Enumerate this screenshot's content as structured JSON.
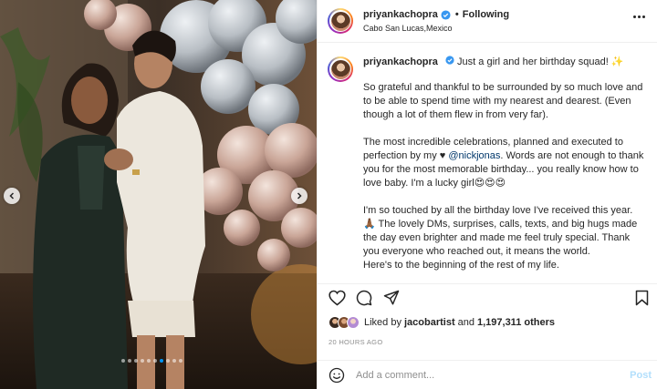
{
  "header": {
    "username": "priyankachopra",
    "separator": "•",
    "follow_status": "Following",
    "location": "Cabo San Lucas,Mexico"
  },
  "caption": {
    "username": "priyankachopra",
    "first_line": "Just a girl and her birthday squad! ✨",
    "paragraphs": [
      "So grateful and thankful to be surrounded by so much love and to be able to spend time with my nearest and dearest. (Even though a lot of them flew in from very far).",
      "The most incredible celebrations, planned and executed to perfection by my ♥",
      "I'm so touched by all the birthday love I've received this year. 🙏🏾 The lovely DMs, surprises, calls, texts, and big hugs made the day even brighter and made me feel truly special. Thank you everyone who reached out, it means the world.",
      "Here's to the beginning of the rest of my life."
    ],
    "mention": "@nickjonas",
    "para2_rest": ". Words are not enough to thank you for the most memorable birthday... you really know how to love baby. I'm a lucky girl😍😍😍"
  },
  "likes": {
    "prefix": "Liked by",
    "user": "jacobartist",
    "joiner": "and",
    "count": "1,197,311 others"
  },
  "timestamp": "20 HOURS AGO",
  "comment": {
    "placeholder": "Add a comment...",
    "post_label": "Post"
  },
  "carousel": {
    "total": 10,
    "active_index": 6
  },
  "colors": {
    "link": "#00376b",
    "post_button": "#b2dffc",
    "active_dot": "#0095f6",
    "verified": "#3897f0"
  },
  "icons": {
    "verified": "verified-badge-icon",
    "more": "more-options-icon",
    "like": "heart-icon",
    "comment": "comment-icon",
    "share": "paper-plane-icon",
    "save": "bookmark-icon",
    "emoji": "emoji-icon",
    "prev": "chevron-left-icon",
    "next": "chevron-right-icon"
  }
}
